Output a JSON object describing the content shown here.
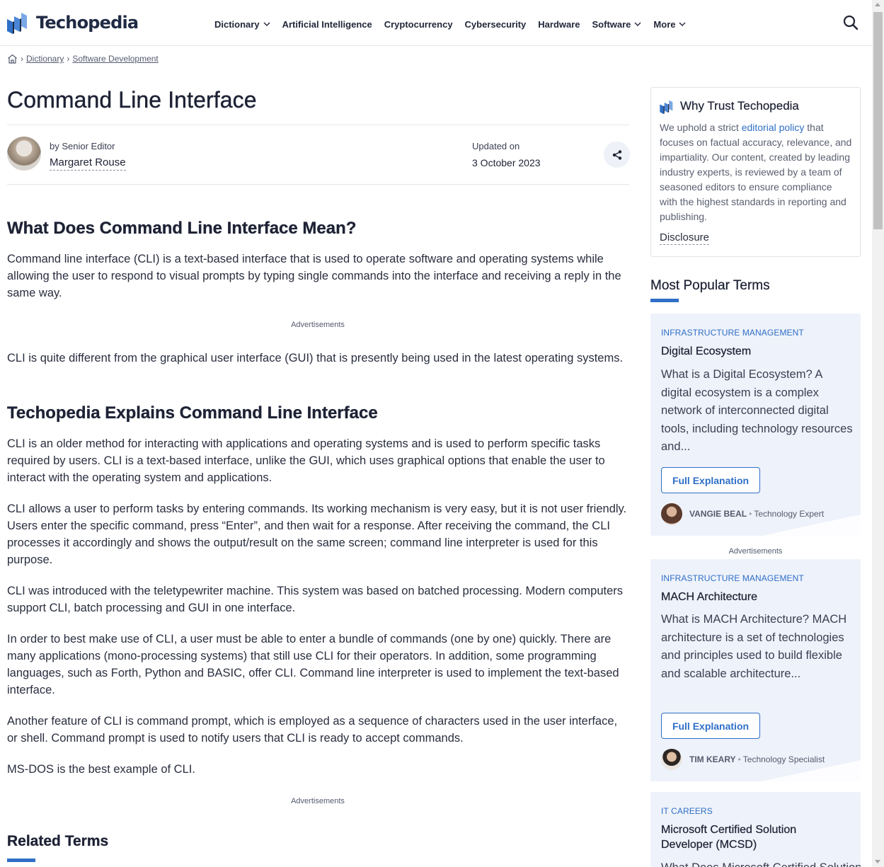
{
  "brand": {
    "name": "Techopedia",
    "accent": "#2f6fc7",
    "dark": "#1f2a44"
  },
  "nav": {
    "items": [
      {
        "label": "Dictionary",
        "has_dropdown": true
      },
      {
        "label": "Artificial Intelligence",
        "has_dropdown": false
      },
      {
        "label": "Cryptocurrency",
        "has_dropdown": false
      },
      {
        "label": "Cybersecurity",
        "has_dropdown": false
      },
      {
        "label": "Hardware",
        "has_dropdown": false
      },
      {
        "label": "Software",
        "has_dropdown": true
      },
      {
        "label": "More",
        "has_dropdown": true
      }
    ],
    "search_icon": "search-icon"
  },
  "breadcrumb": {
    "home_icon": "home-icon",
    "items": [
      "Dictionary",
      "Software Development"
    ]
  },
  "article": {
    "title": "Command Line Interface",
    "by_label": "by Senior Editor",
    "author": "Margaret Rouse",
    "updated_label": "Updated on",
    "updated_date": "3 October 2023",
    "share_icon": "share-icon",
    "h2_meaning": "What Does Command Line Interface Mean?",
    "p1": "Command line interface (CLI) is a text-based interface that is used to operate software and operating systems while allowing the user to respond to visual prompts by typing single commands into the interface and receiving a reply in the same way.",
    "ad_label": "Advertisements",
    "p2": "CLI is quite different from the graphical user interface (GUI) that is presently being used in the latest operating systems.",
    "h2_explains": "Techopedia Explains Command Line Interface",
    "p3": "CLI is an older method for interacting with applications and operating systems and is used to perform specific tasks required by users. CLI is a text-based interface, unlike the GUI, which uses graphical options that enable the user to interact with the operating system and applications.",
    "p4": "CLI allows a user to perform tasks by entering commands. Its working mechanism is very easy, but it is not user friendly. Users enter the specific command, press “Enter”, and then wait for a response. After receiving the command, the CLI processes it accordingly and shows the output/result on the same screen; command line interpreter is used for this purpose.",
    "p5": "CLI was introduced with the teletypewriter machine. This system was based on batched processing. Modern computers support CLI, batch processing and GUI in one interface.",
    "p6": "In order to best make use of CLI, a user must be able to enter a bundle of commands (one by one) quickly. There are many applications (mono-processing systems) that still use CLI for their operators. In addition, some programming languages, such as Forth, Python and BASIC, offer CLI. Command line interpreter is used to implement the text-based interface.",
    "p7": "Another feature of CLI is command prompt, which is employed as a sequence of characters used in the user interface, or shell. Command prompt is used to notify users that CLI is ready to accept commands.",
    "p8": "MS-DOS is the best example of CLI.",
    "related_title": "Related Terms"
  },
  "trust": {
    "title": "Why Trust Techopedia",
    "text_before": "We uphold a strict ",
    "link": "editorial policy",
    "text_after": " that focuses on factual accuracy, relevance, and impartiality. Our content, created by leading industry experts, is reviewed by a team of seasoned editors to ensure compliance with the highest standards in reporting and publishing.",
    "disclosure": "Disclosure"
  },
  "popular": {
    "title": "Most Popular Terms",
    "ad_label": "Advertisements",
    "cards": [
      {
        "category": "INFRASTRUCTURE MANAGEMENT",
        "title": "Digital Ecosystem",
        "desc": "What is a Digital Ecosystem? A digital ecosystem is a complex network of interconnected digital tools, including technology resources and...",
        "button": "Full Explanation",
        "author": "VANGIE BEAL",
        "role": "Technology Expert"
      },
      {
        "category": "INFRASTRUCTURE MANAGEMENT",
        "title": "MACH Architecture",
        "desc": "What is MACH Architecture? MACH architecture is a set of technologies and principles used to build flexible and scalable architecture...",
        "button": "Full Explanation",
        "author": "TIM KEARY",
        "role": "Technology Specialist"
      },
      {
        "category": "IT CAREERS",
        "title": "Microsoft Certified Solution Developer (MCSD)",
        "desc": "What Does Microsoft Certified Solution Developer (MCSD) Mean?"
      }
    ]
  }
}
